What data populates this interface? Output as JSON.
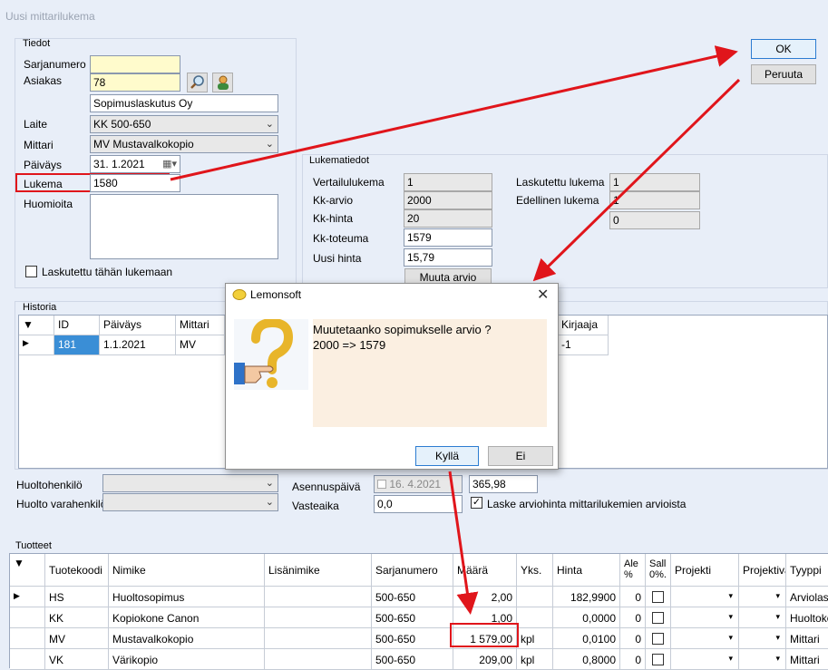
{
  "window": {
    "title": "Uusi mittarilukema"
  },
  "buttons": {
    "ok": "OK",
    "cancel": "Peruuta"
  },
  "tiedot": {
    "title": "Tiedot",
    "sarjanumero_label": "Sarjanumero",
    "sarjanumero_value": "",
    "asiakas_label": "Asiakas",
    "asiakas_value": "78",
    "asiakas_name": "Sopimuslaskutus Oy",
    "laite_label": "Laite",
    "laite_value": "KK  500-650",
    "mittari_label": "Mittari",
    "mittari_value": "MV  Mustavalkokopio",
    "paivays_label": "Päiväys",
    "paivays_value": "31.  1.2021",
    "lukema_label": "Lukema",
    "lukema_value": "1580",
    "huomioita_label": "Huomioita",
    "huomioita_value": "",
    "laskutettu_label": "Laskutettu tähän lukemaan"
  },
  "lukematiedot": {
    "title": "Lukematiedot",
    "vertailulukema_label": "Vertailulukema",
    "vertailulukema_value": "1",
    "kkarvio_label": "Kk-arvio",
    "kkarvio_value": "2000",
    "kkhinta_label": "Kk-hinta",
    "kkhinta_value": "20",
    "kktoteuma_label": "Kk-toteuma",
    "kktoteuma_value": "1579",
    "uusihinta_label": "Uusi hinta",
    "uusihinta_value": "15,79",
    "muuta_arvio": "Muuta arvio",
    "laskutettu_lukema_label": "Laskutettu lukema",
    "laskutettu_lukema_value": "1",
    "edellinen_lukema_label": "Edellinen lukema",
    "edellinen_lukema_value": "1",
    "extra_value": "0"
  },
  "historia": {
    "title": "Historia",
    "columns": {
      "id": "ID",
      "paivays": "Päiväys",
      "mittari": "Mittari",
      "kirjaaja": "Kirjaaja"
    },
    "rows": [
      {
        "id": "181",
        "paivays": "1.1.2021",
        "mittari": "MV",
        "kirjaaja": "-1"
      }
    ]
  },
  "lower": {
    "huoltohenkilo_label": "Huoltohenkilö",
    "huolto_varahenkilo_label": "Huolto varahenkilö",
    "asennuspaiva_label": "Asennuspäivä",
    "asennuspaiva_value": "16.  4.2021",
    "vasteaika_label": "Vasteaika",
    "vasteaika_value": "0,0",
    "value_365": "365,98",
    "laske_label": "Laske arviohinta mittarilukemien arvioista"
  },
  "tuotteet": {
    "title": "Tuotteet",
    "columns": {
      "tuotekoodi": "Tuotekoodi",
      "nimike": "Nimike",
      "lisanimike": "Lisänimike",
      "sarjanumero": "Sarjanumero",
      "maara": "Määrä",
      "yks": "Yks.",
      "hinta": "Hinta",
      "ale": "Ale %",
      "sall": "Sall 0%.",
      "projekti": "Projekti",
      "projektiva": "Projektiva",
      "tyyppi": "Tyyppi"
    },
    "rows": [
      {
        "koodi": "HS",
        "nimike": "Huoltosopimus",
        "sarja": "500-650",
        "maara": "2,00",
        "yks": "",
        "hinta": "182,9900",
        "ale": "0",
        "tyyppi": "Arviolask"
      },
      {
        "koodi": "KK",
        "nimike": "Kopiokone Canon",
        "sarja": "500-650",
        "maara": "1,00",
        "yks": "",
        "hinta": "0,0000",
        "ale": "0",
        "tyyppi": "Huoltoko"
      },
      {
        "koodi": "MV",
        "nimike": "Mustavalkokopio",
        "sarja": "500-650",
        "maara": "1 579,00",
        "yks": "kpl",
        "hinta": "0,0100",
        "ale": "0",
        "tyyppi": "Mittari"
      },
      {
        "koodi": "VK",
        "nimike": "Värikopio",
        "sarja": "500-650",
        "maara": "209,00",
        "yks": "kpl",
        "hinta": "0,8000",
        "ale": "0",
        "tyyppi": "Mittari"
      }
    ]
  },
  "dialog": {
    "title": "Lemonsoft",
    "message_line1": "Muutetaanko sopimukselle arvio ?",
    "message_line2": "2000 => 1579",
    "yes": "Kyllä",
    "no": "Ei"
  },
  "colors": {
    "annotation_red": "#e0151b",
    "selection_blue": "#3a8ed6",
    "input_yellow": "#fffbcc"
  }
}
